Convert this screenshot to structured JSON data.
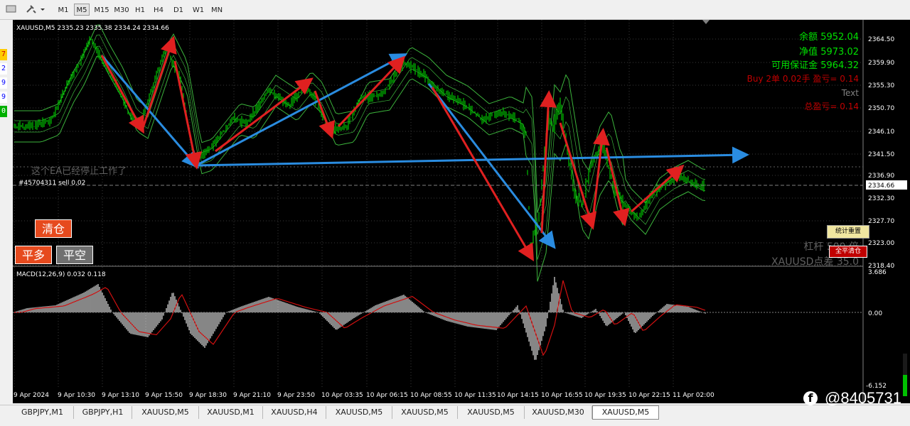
{
  "toolbar": {
    "timeframes": [
      "M1",
      "M5",
      "M15",
      "M30",
      "H1",
      "H4",
      "D1",
      "W1",
      "MN"
    ],
    "active_timeframe": "M5"
  },
  "left_numbers": [
    "7",
    "2",
    "9",
    "9",
    "0"
  ],
  "chart": {
    "symbol_line": "XAUUSD,M5  2335.23 2335.38 2334.24 2334.66",
    "stopped_text": "这个EA已经停止工作了",
    "order_label": "#45704311 sell 0.02",
    "price_axis": [
      "2364.50",
      "2359.90",
      "2355.30",
      "2350.70",
      "2346.10",
      "2341.50",
      "2336.90",
      "2332.30",
      "2327.70",
      "2323.00",
      "2318.40"
    ],
    "current_price": "2334.66",
    "time_axis": [
      "9 Apr 2024",
      "9 Apr 10:30",
      "9 Apr 13:10",
      "9 Apr 15:50",
      "9 Apr 18:30",
      "9 Apr 21:10",
      "9 Apr 23:50",
      "10 Apr 03:35",
      "10 Apr 06:15",
      "10 Apr 08:55",
      "10 Apr 11:35",
      "10 Apr 14:15",
      "10 Apr 16:55",
      "10 Apr 19:35",
      "10 Apr 22:15",
      "11 Apr 02:00"
    ],
    "macd_label": "MACD(12,26,9) 0.032 0.118",
    "macd_axis": [
      "3.686",
      "0.00",
      "-6.152"
    ],
    "info": {
      "balance": "余额 5952.04",
      "equity": "净值 5973.02",
      "margin": "可用保证金 5964.32",
      "buy_line": "Buy 2单    0.02手   盈亏= 0.14",
      "text": "Text",
      "total": "总盈亏= 0.14",
      "leverage": "杠杆   500 倍",
      "spread": "XAUUSD点差 35.0",
      "reset_button": "统计重置",
      "close_all_button": "全平清仓"
    },
    "colors": {
      "bull": "#00c000",
      "band": "#3cb43c",
      "arrow_red": "#e02020",
      "arrow_blue": "#2a8ce0",
      "macd_hist": "#c0c0c0",
      "macd_signal": "#d01010"
    }
  },
  "buttons": {
    "clear": "清仓",
    "close_long": "平多",
    "close_short": "平空"
  },
  "tabs": [
    "GBPJPY,M1",
    "GBPJPY,H1",
    "XAUUSD,M5",
    "XAUUSD,M1",
    "XAUUSD,H4",
    "XAUUSD,M5",
    "XAUUSD,M5",
    "XAUUSD,M5",
    "XAUUSD,M30",
    "XAUUSD,M5"
  ],
  "active_tab": 9,
  "watermark": "@8405731"
}
